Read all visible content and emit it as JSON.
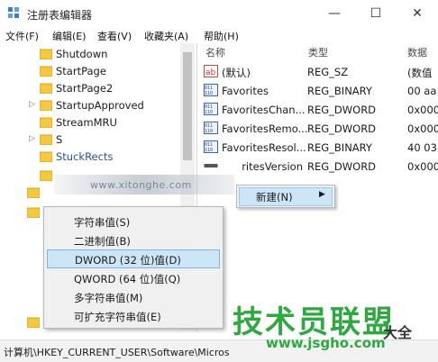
{
  "window": {
    "title": "注册表编辑器"
  },
  "window_controls": {
    "minimize": "—",
    "maximize": "☐",
    "close": "✕"
  },
  "menu": [
    "文件(F)",
    "编辑(E)",
    "查看(V)",
    "收藏夹(A)",
    "帮助(H)"
  ],
  "tree": [
    {
      "label": "Shutdown",
      "expander": ""
    },
    {
      "label": "StartPage",
      "expander": ""
    },
    {
      "label": "StartPage2",
      "expander": ""
    },
    {
      "label": "StartupApproved",
      "expander": "▷"
    },
    {
      "label": "StreamMRU",
      "expander": ""
    },
    {
      "label": "S",
      "expander": "▷"
    },
    {
      "label": "StuckRects",
      "expander": ""
    }
  ],
  "columns": {
    "name": "名称",
    "type": "类型",
    "data": "数据"
  },
  "values": [
    {
      "icon": "string-value-icon",
      "name": "(默认)",
      "type": "REG_SZ",
      "data": "(数值"
    },
    {
      "icon": "binary-value-icon",
      "name": "Favorites",
      "type": "REG_BINARY",
      "data": "00 aa"
    },
    {
      "icon": "binary-value-icon",
      "name": "FavoritesChan...",
      "type": "REG_DWORD",
      "data": "0x000"
    },
    {
      "icon": "binary-value-icon",
      "name": "FavoritesRemo...",
      "type": "REG_DWORD",
      "data": "0x000"
    },
    {
      "icon": "binary-value-icon",
      "name": "FavoritesResol...",
      "type": "REG_BINARY",
      "data": "40 03"
    },
    {
      "icon": "binary-value-icon",
      "name": "ritesVersion",
      "type": "REG_DWORD",
      "data": "0x000"
    }
  ],
  "context_menu": {
    "new_label": "新建(N)",
    "arrow": "▶"
  },
  "submenu": [
    "字符串值(S)",
    "二进制值(B)",
    "DWORD (32 位)值(D)",
    "QWORD (64 位)值(Q)",
    "多字符串值(M)",
    "可扩充字符串值(E)"
  ],
  "submenu_highlight_index": 2,
  "status_path": "计算机\\HKEY_CURRENT_USER\\Software\\Micros",
  "watermarks": {
    "url_blur": "www.xitonghe.com",
    "logo": "技术员联盟",
    "logo_suffix": "大全",
    "logo_url": "www.jsgho.com"
  },
  "colors": {
    "accent_highlight": "#cde6f7",
    "folder": "#f5c842",
    "logo_green": "#2da93f"
  }
}
